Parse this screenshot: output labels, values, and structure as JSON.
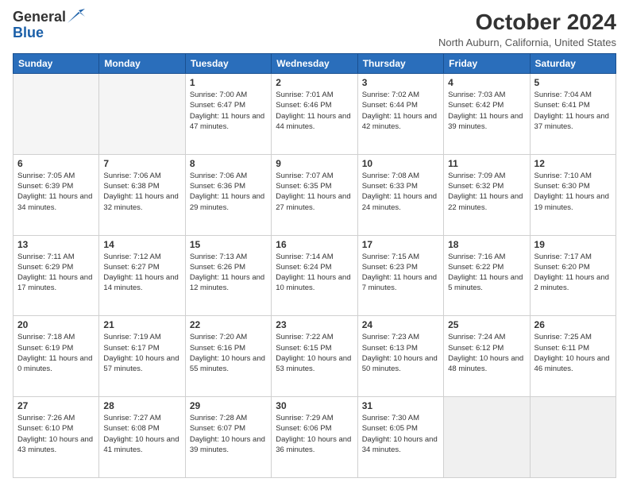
{
  "header": {
    "logo_general": "General",
    "logo_blue": "Blue",
    "month_title": "October 2024",
    "location": "North Auburn, California, United States"
  },
  "days_of_week": [
    "Sunday",
    "Monday",
    "Tuesday",
    "Wednesday",
    "Thursday",
    "Friday",
    "Saturday"
  ],
  "weeks": [
    [
      {
        "day": null,
        "empty": true
      },
      {
        "day": null,
        "empty": true
      },
      {
        "day": 1,
        "sunrise": "7:00 AM",
        "sunset": "6:47 PM",
        "daylight": "11 hours and 47 minutes."
      },
      {
        "day": 2,
        "sunrise": "7:01 AM",
        "sunset": "6:46 PM",
        "daylight": "11 hours and 44 minutes."
      },
      {
        "day": 3,
        "sunrise": "7:02 AM",
        "sunset": "6:44 PM",
        "daylight": "11 hours and 42 minutes."
      },
      {
        "day": 4,
        "sunrise": "7:03 AM",
        "sunset": "6:42 PM",
        "daylight": "11 hours and 39 minutes."
      },
      {
        "day": 5,
        "sunrise": "7:04 AM",
        "sunset": "6:41 PM",
        "daylight": "11 hours and 37 minutes."
      }
    ],
    [
      {
        "day": 6,
        "sunrise": "7:05 AM",
        "sunset": "6:39 PM",
        "daylight": "11 hours and 34 minutes."
      },
      {
        "day": 7,
        "sunrise": "7:06 AM",
        "sunset": "6:38 PM",
        "daylight": "11 hours and 32 minutes."
      },
      {
        "day": 8,
        "sunrise": "7:06 AM",
        "sunset": "6:36 PM",
        "daylight": "11 hours and 29 minutes."
      },
      {
        "day": 9,
        "sunrise": "7:07 AM",
        "sunset": "6:35 PM",
        "daylight": "11 hours and 27 minutes."
      },
      {
        "day": 10,
        "sunrise": "7:08 AM",
        "sunset": "6:33 PM",
        "daylight": "11 hours and 24 minutes."
      },
      {
        "day": 11,
        "sunrise": "7:09 AM",
        "sunset": "6:32 PM",
        "daylight": "11 hours and 22 minutes."
      },
      {
        "day": 12,
        "sunrise": "7:10 AM",
        "sunset": "6:30 PM",
        "daylight": "11 hours and 19 minutes."
      }
    ],
    [
      {
        "day": 13,
        "sunrise": "7:11 AM",
        "sunset": "6:29 PM",
        "daylight": "11 hours and 17 minutes."
      },
      {
        "day": 14,
        "sunrise": "7:12 AM",
        "sunset": "6:27 PM",
        "daylight": "11 hours and 14 minutes."
      },
      {
        "day": 15,
        "sunrise": "7:13 AM",
        "sunset": "6:26 PM",
        "daylight": "11 hours and 12 minutes."
      },
      {
        "day": 16,
        "sunrise": "7:14 AM",
        "sunset": "6:24 PM",
        "daylight": "11 hours and 10 minutes."
      },
      {
        "day": 17,
        "sunrise": "7:15 AM",
        "sunset": "6:23 PM",
        "daylight": "11 hours and 7 minutes."
      },
      {
        "day": 18,
        "sunrise": "7:16 AM",
        "sunset": "6:22 PM",
        "daylight": "11 hours and 5 minutes."
      },
      {
        "day": 19,
        "sunrise": "7:17 AM",
        "sunset": "6:20 PM",
        "daylight": "11 hours and 2 minutes."
      }
    ],
    [
      {
        "day": 20,
        "sunrise": "7:18 AM",
        "sunset": "6:19 PM",
        "daylight": "11 hours and 0 minutes."
      },
      {
        "day": 21,
        "sunrise": "7:19 AM",
        "sunset": "6:17 PM",
        "daylight": "10 hours and 57 minutes."
      },
      {
        "day": 22,
        "sunrise": "7:20 AM",
        "sunset": "6:16 PM",
        "daylight": "10 hours and 55 minutes."
      },
      {
        "day": 23,
        "sunrise": "7:22 AM",
        "sunset": "6:15 PM",
        "daylight": "10 hours and 53 minutes."
      },
      {
        "day": 24,
        "sunrise": "7:23 AM",
        "sunset": "6:13 PM",
        "daylight": "10 hours and 50 minutes."
      },
      {
        "day": 25,
        "sunrise": "7:24 AM",
        "sunset": "6:12 PM",
        "daylight": "10 hours and 48 minutes."
      },
      {
        "day": 26,
        "sunrise": "7:25 AM",
        "sunset": "6:11 PM",
        "daylight": "10 hours and 46 minutes."
      }
    ],
    [
      {
        "day": 27,
        "sunrise": "7:26 AM",
        "sunset": "6:10 PM",
        "daylight": "10 hours and 43 minutes."
      },
      {
        "day": 28,
        "sunrise": "7:27 AM",
        "sunset": "6:08 PM",
        "daylight": "10 hours and 41 minutes."
      },
      {
        "day": 29,
        "sunrise": "7:28 AM",
        "sunset": "6:07 PM",
        "daylight": "10 hours and 39 minutes."
      },
      {
        "day": 30,
        "sunrise": "7:29 AM",
        "sunset": "6:06 PM",
        "daylight": "10 hours and 36 minutes."
      },
      {
        "day": 31,
        "sunrise": "7:30 AM",
        "sunset": "6:05 PM",
        "daylight": "10 hours and 34 minutes."
      },
      {
        "day": null,
        "empty": true
      },
      {
        "day": null,
        "empty": true
      }
    ]
  ],
  "labels": {
    "sunrise_prefix": "Sunrise: ",
    "sunset_prefix": "Sunset: ",
    "daylight_prefix": "Daylight: "
  }
}
